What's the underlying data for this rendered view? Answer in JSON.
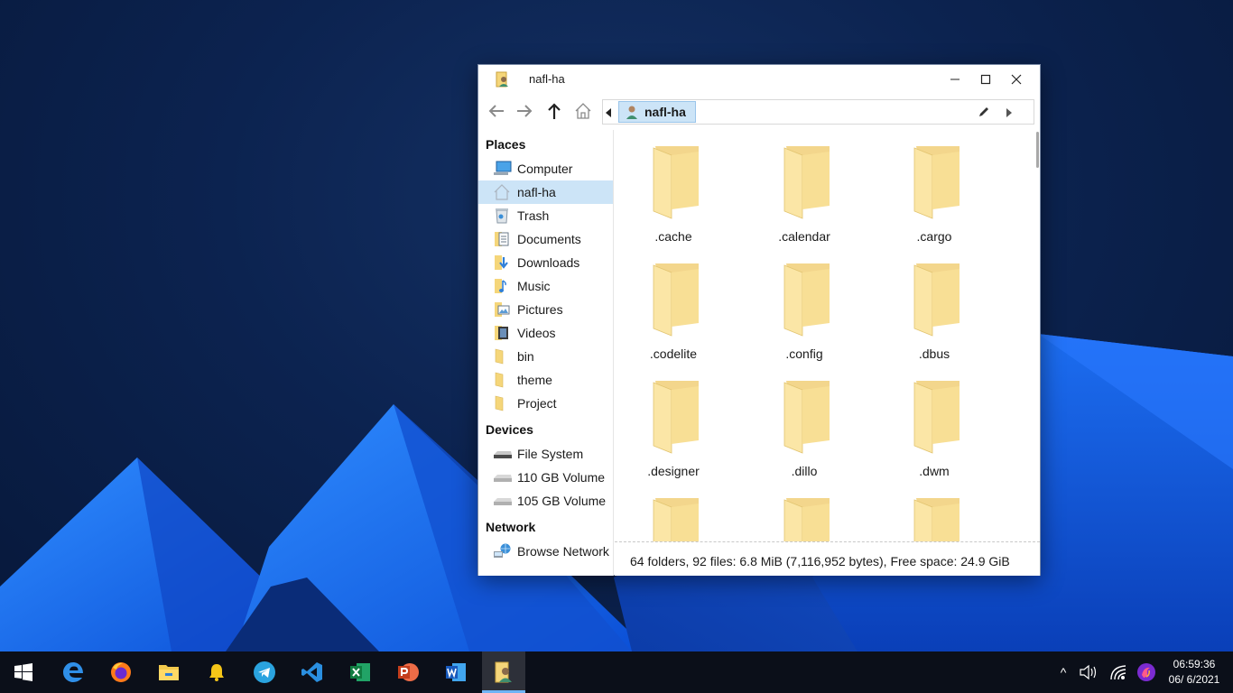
{
  "window": {
    "title": "nafl-ha",
    "path_segment": "nafl-ha"
  },
  "sidebar": {
    "sections": [
      {
        "heading": "Places",
        "items": [
          {
            "label": "Computer",
            "icon": "computer-icon"
          },
          {
            "label": "nafl-ha",
            "icon": "home-icon",
            "selected": true
          },
          {
            "label": "Trash",
            "icon": "trash-icon"
          },
          {
            "label": "Documents",
            "icon": "documents-folder-icon"
          },
          {
            "label": "Downloads",
            "icon": "downloads-folder-icon"
          },
          {
            "label": "Music",
            "icon": "music-folder-icon"
          },
          {
            "label": "Pictures",
            "icon": "pictures-folder-icon"
          },
          {
            "label": "Videos",
            "icon": "videos-folder-icon"
          },
          {
            "label": "bin",
            "icon": "folder-icon"
          },
          {
            "label": "theme",
            "icon": "folder-icon"
          },
          {
            "label": "Project",
            "icon": "folder-icon"
          }
        ]
      },
      {
        "heading": "Devices",
        "items": [
          {
            "label": "File System",
            "icon": "drive-icon"
          },
          {
            "label": "110 GB Volume",
            "icon": "drive-icon"
          },
          {
            "label": "105 GB Volume",
            "icon": "drive-icon"
          }
        ]
      },
      {
        "heading": "Network",
        "items": [
          {
            "label": "Browse Network",
            "icon": "network-icon"
          }
        ]
      }
    ]
  },
  "files": [
    {
      "name": ".cache"
    },
    {
      "name": ".calendar"
    },
    {
      "name": ".cargo"
    },
    {
      "name": ".codelite"
    },
    {
      "name": ".config"
    },
    {
      "name": ".dbus"
    },
    {
      "name": ".designer"
    },
    {
      "name": ".dillo"
    },
    {
      "name": ".dwm"
    },
    {
      "name": ""
    },
    {
      "name": ""
    },
    {
      "name": ""
    }
  ],
  "status": {
    "text": "64 folders, 92 files: 6.8 MiB (7,116,952 bytes), Free space: 24.9 GiB"
  },
  "taskbar": {
    "apps": [
      {
        "name": "start-menu",
        "icon": "windows-logo-icon"
      },
      {
        "name": "edge",
        "icon": "edge-icon"
      },
      {
        "name": "firefox",
        "icon": "firefox-icon"
      },
      {
        "name": "file-explorer",
        "icon": "file-explorer-icon"
      },
      {
        "name": "notifications",
        "icon": "bell-icon"
      },
      {
        "name": "telegram",
        "icon": "telegram-icon"
      },
      {
        "name": "vscode",
        "icon": "vscode-icon"
      },
      {
        "name": "excel",
        "icon": "excel-icon"
      },
      {
        "name": "powerpoint",
        "icon": "powerpoint-icon"
      },
      {
        "name": "word",
        "icon": "word-icon"
      },
      {
        "name": "file-manager",
        "icon": "file-manager-icon",
        "active": true
      }
    ],
    "tray": {
      "chevron": "^",
      "time": "06:59:36",
      "date": "06/ 6/2021"
    }
  }
}
